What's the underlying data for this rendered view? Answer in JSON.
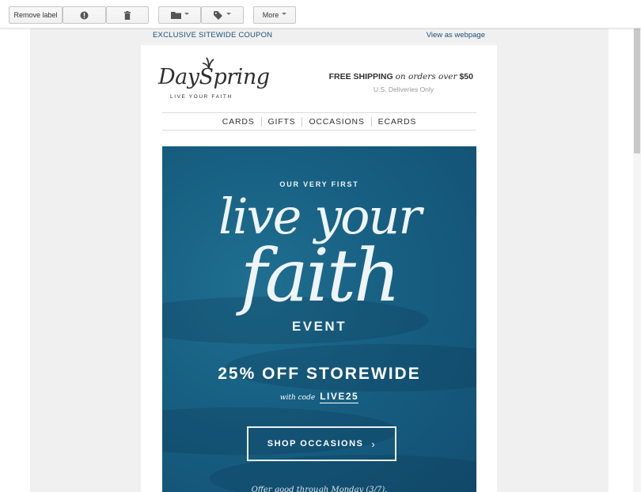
{
  "toolbar": {
    "remove_label": "Remove label",
    "report_icon": "exclamation-icon",
    "delete_icon": "trash-icon",
    "move_icon": "folder-icon",
    "labels_icon": "tag-icon",
    "more_label": "More"
  },
  "email": {
    "preheader": "EXCLUSIVE SITEWIDE COUPON",
    "view_webpage": "View as webpage",
    "brand_name": "DaySpring",
    "brand_tagline": "LIVE YOUR FAITH",
    "shipping_bold": "FREE SHIPPING",
    "shipping_italic": "on orders over",
    "shipping_amount": "$50",
    "shipping_sub": "U.S. Deliveries Only",
    "nav": [
      "CARDS",
      "GIFTS",
      "OCCASIONS",
      "ECARDS"
    ],
    "hero": {
      "pre": "OUR VERY FIRST",
      "script_line1": "live your",
      "script_line2": "faith",
      "event": "EVENT",
      "offer": "25% OFF STOREWIDE",
      "code_prefix": "with code",
      "code": "LIVE25",
      "cta": "SHOP OCCASIONS",
      "fine_print": "Offer good through Monday (3/7)."
    }
  },
  "colors": {
    "link": "#1a4e78",
    "hero_bg": "#175f82",
    "panel_bg": "#f0f0f0"
  }
}
